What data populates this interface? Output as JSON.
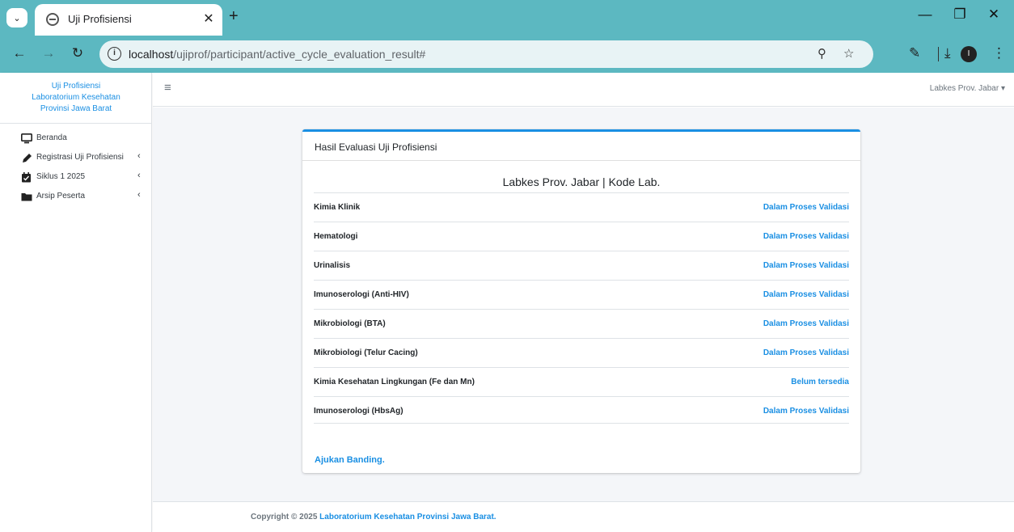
{
  "browser": {
    "tab_title": "Uji Profisiensi",
    "url_host": "localhost",
    "url_path": "/ujiprof/participant/active_cycle_evaluation_result#",
    "profile_initial": "I",
    "accent_color": "#5cb8c1"
  },
  "sidebar": {
    "brand_line1": "Uji Profisiensi",
    "brand_line2": "Laboratorium Kesehatan",
    "brand_line3": "Provinsi Jawa Barat",
    "items": [
      {
        "label": "Beranda",
        "icon": "monitor-icon"
      },
      {
        "label": "Registrasi Uji Profisiensi",
        "icon": "pen-icon"
      },
      {
        "label": "Siklus 1 2025",
        "icon": "calendar-check-icon"
      },
      {
        "label": "Arsip Peserta",
        "icon": "folder-icon"
      }
    ]
  },
  "topbar": {
    "user_name": "Labkes Prov. Jabar"
  },
  "card": {
    "title": "Hasil Evaluasi Uji Profisiensi",
    "lab_heading": "Labkes Prov. Jabar | Kode Lab.",
    "rows": [
      {
        "name": "Kimia Klinik",
        "status": "Dalam Proses Validasi"
      },
      {
        "name": "Hematologi",
        "status": "Dalam Proses Validasi"
      },
      {
        "name": "Urinalisis",
        "status": "Dalam Proses Validasi"
      },
      {
        "name": "Imunoserologi (Anti-HIV)",
        "status": "Dalam Proses Validasi"
      },
      {
        "name": "Mikrobiologi (BTA)",
        "status": "Dalam Proses Validasi"
      },
      {
        "name": "Mikrobiologi (Telur Cacing)",
        "status": "Dalam Proses Validasi"
      },
      {
        "name": "Kimia Kesehatan Lingkungan (Fe dan Mn)",
        "status": "Belum tersedia"
      },
      {
        "name": "Imunoserologi (HbsAg)",
        "status": "Dalam Proses Validasi"
      }
    ],
    "appeal_link": "Ajukan Banding."
  },
  "footer": {
    "copyright": "Copyright © 2025",
    "org_link": "Laboratorium Kesehatan Provinsi Jawa Barat."
  },
  "colors": {
    "link": "#1a8fe3",
    "content_bg": "#f4f6f9"
  }
}
